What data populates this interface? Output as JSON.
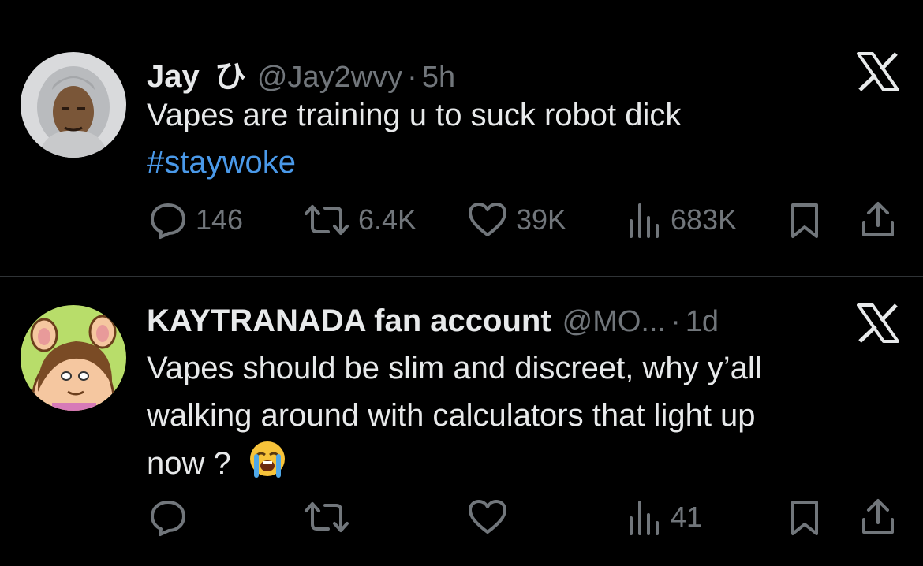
{
  "tweets": [
    {
      "name": "Jay",
      "name_glyph": "ひ",
      "handle": "@Jay2wvy",
      "separator": "·",
      "time": "5h",
      "lines": [
        "Vapes are training u to suck robot dick"
      ],
      "hashtag": "#staywoke",
      "replies": "146",
      "retweets": "6.4K",
      "likes": "39K",
      "views": "683K"
    },
    {
      "name": "KAYTRANADA fan account",
      "handle": "@MO...",
      "separator": "·",
      "time": "1d",
      "lines": [
        "Vapes should be slim and discreet, why y’all",
        "walking around with calculators that light up",
        "now ?"
      ],
      "emoji": "loudly-crying-face",
      "replies": "",
      "retweets": "",
      "likes": "",
      "views": "41"
    }
  ],
  "colors": {
    "background": "#000000",
    "text": "#e7e9ea",
    "muted": "#71767b",
    "hashtag": "#4a99e9",
    "divider": "#2f3336"
  },
  "icons": [
    "reply-icon",
    "retweet-icon",
    "like-icon",
    "views-icon",
    "bookmark-icon",
    "share-icon",
    "x-logo-icon"
  ]
}
